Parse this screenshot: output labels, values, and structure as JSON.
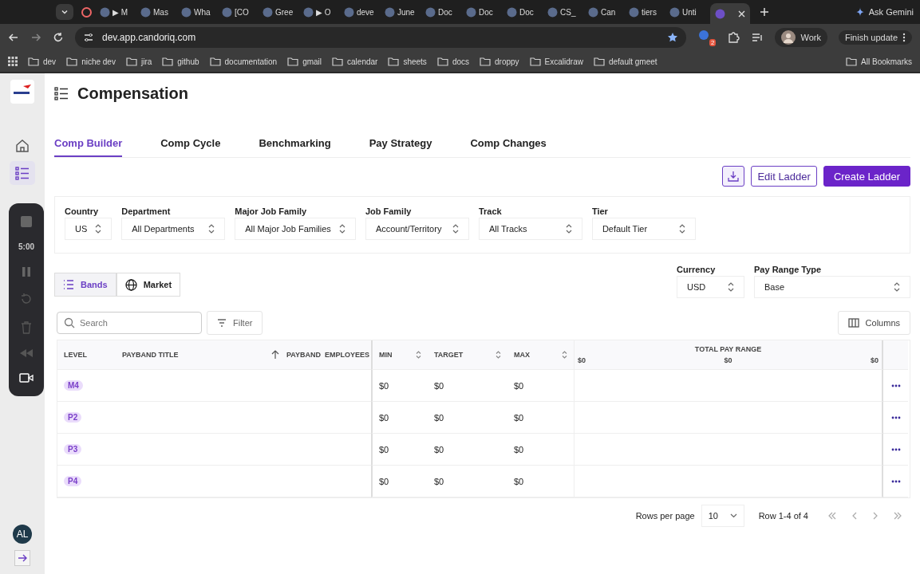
{
  "browser": {
    "tabs": [
      {
        "label": "▶ M",
        "selected": false
      },
      {
        "label": "Mas",
        "selected": false
      },
      {
        "label": "Wha",
        "selected": false
      },
      {
        "label": "[CO",
        "selected": false
      },
      {
        "label": "Gree",
        "selected": false
      },
      {
        "label": "▶ O",
        "selected": false
      },
      {
        "label": "deve",
        "selected": false
      },
      {
        "label": "June",
        "selected": false
      },
      {
        "label": "Doc",
        "selected": false
      },
      {
        "label": "Doc",
        "selected": false
      },
      {
        "label": "Doc",
        "selected": false
      },
      {
        "label": "CS_",
        "selected": false
      },
      {
        "label": "Can",
        "selected": false
      },
      {
        "label": "tiers",
        "selected": false
      },
      {
        "label": "Unti",
        "selected": false
      },
      {
        "selected": true
      }
    ],
    "ask_gemini": "Ask Gemini",
    "url": "dev.app.candoriq.com",
    "extension_badge": "2",
    "profile": "Work",
    "finish_update": "Finish update",
    "bookmarks": [
      "dev",
      "niche dev",
      "jira",
      "github",
      "documentation",
      "gmail",
      "calendar",
      "sheets",
      "docs",
      "droppy",
      "Excalidraw",
      "default gmeet"
    ],
    "all_bookmarks": "All Bookmarks"
  },
  "recorder": {
    "timer": "5:00"
  },
  "sidebar": {
    "avatar": "AL"
  },
  "page": {
    "title": "Compensation",
    "tabs": [
      {
        "label": "Comp Builder",
        "selected": true
      },
      {
        "label": "Comp Cycle",
        "selected": false
      },
      {
        "label": "Benchmarking",
        "selected": false
      },
      {
        "label": "Pay Strategy",
        "selected": false
      },
      {
        "label": "Comp Changes",
        "selected": false
      }
    ],
    "buttons": [
      {
        "label": "Edit Ladder",
        "kind": "outline"
      },
      {
        "label": "Create Ladder",
        "kind": "primary"
      }
    ],
    "filters": [
      {
        "label": "Country",
        "value": "US"
      },
      {
        "label": "Department",
        "value": "All Departments"
      },
      {
        "label": "Major Job Family",
        "value": "All Major Job Families"
      },
      {
        "label": "Job Family",
        "value": "Account/Territory"
      },
      {
        "label": "Track",
        "value": "All Tracks"
      },
      {
        "label": "Tier",
        "value": "Default Tier"
      }
    ],
    "views": [
      {
        "label": "Bands",
        "selected": true
      },
      {
        "label": "Market",
        "selected": false
      }
    ],
    "currency": {
      "label": "Currency",
      "value": "USD"
    },
    "pay_range_type": {
      "label": "Pay Range Type",
      "value": "Base"
    },
    "search": {
      "placeholder": "Search"
    },
    "filter_button": "Filter",
    "columns_button": "Columns"
  },
  "table": {
    "columns": [
      "LEVEL",
      "PAYBAND TITLE",
      "PAYBAND",
      "EMPLOYEES",
      "MIN",
      "TARGET",
      "MAX"
    ],
    "total_pay_range": {
      "title": "TOTAL PAY RANGE",
      "ticks": [
        "$0",
        "$0",
        "$0"
      ]
    },
    "rows": [
      {
        "level": "M4",
        "min": "$0",
        "target": "$0",
        "max": "$0"
      },
      {
        "level": "P2",
        "min": "$0",
        "target": "$0",
        "max": "$0"
      },
      {
        "level": "P3",
        "min": "$0",
        "target": "$0",
        "max": "$0"
      },
      {
        "level": "P4",
        "min": "$0",
        "target": "$0",
        "max": "$0"
      }
    ]
  },
  "pagination": {
    "rows_per_page_label": "Rows per page",
    "rows_per_page": "10",
    "range": "Row 1-4 of 4"
  }
}
